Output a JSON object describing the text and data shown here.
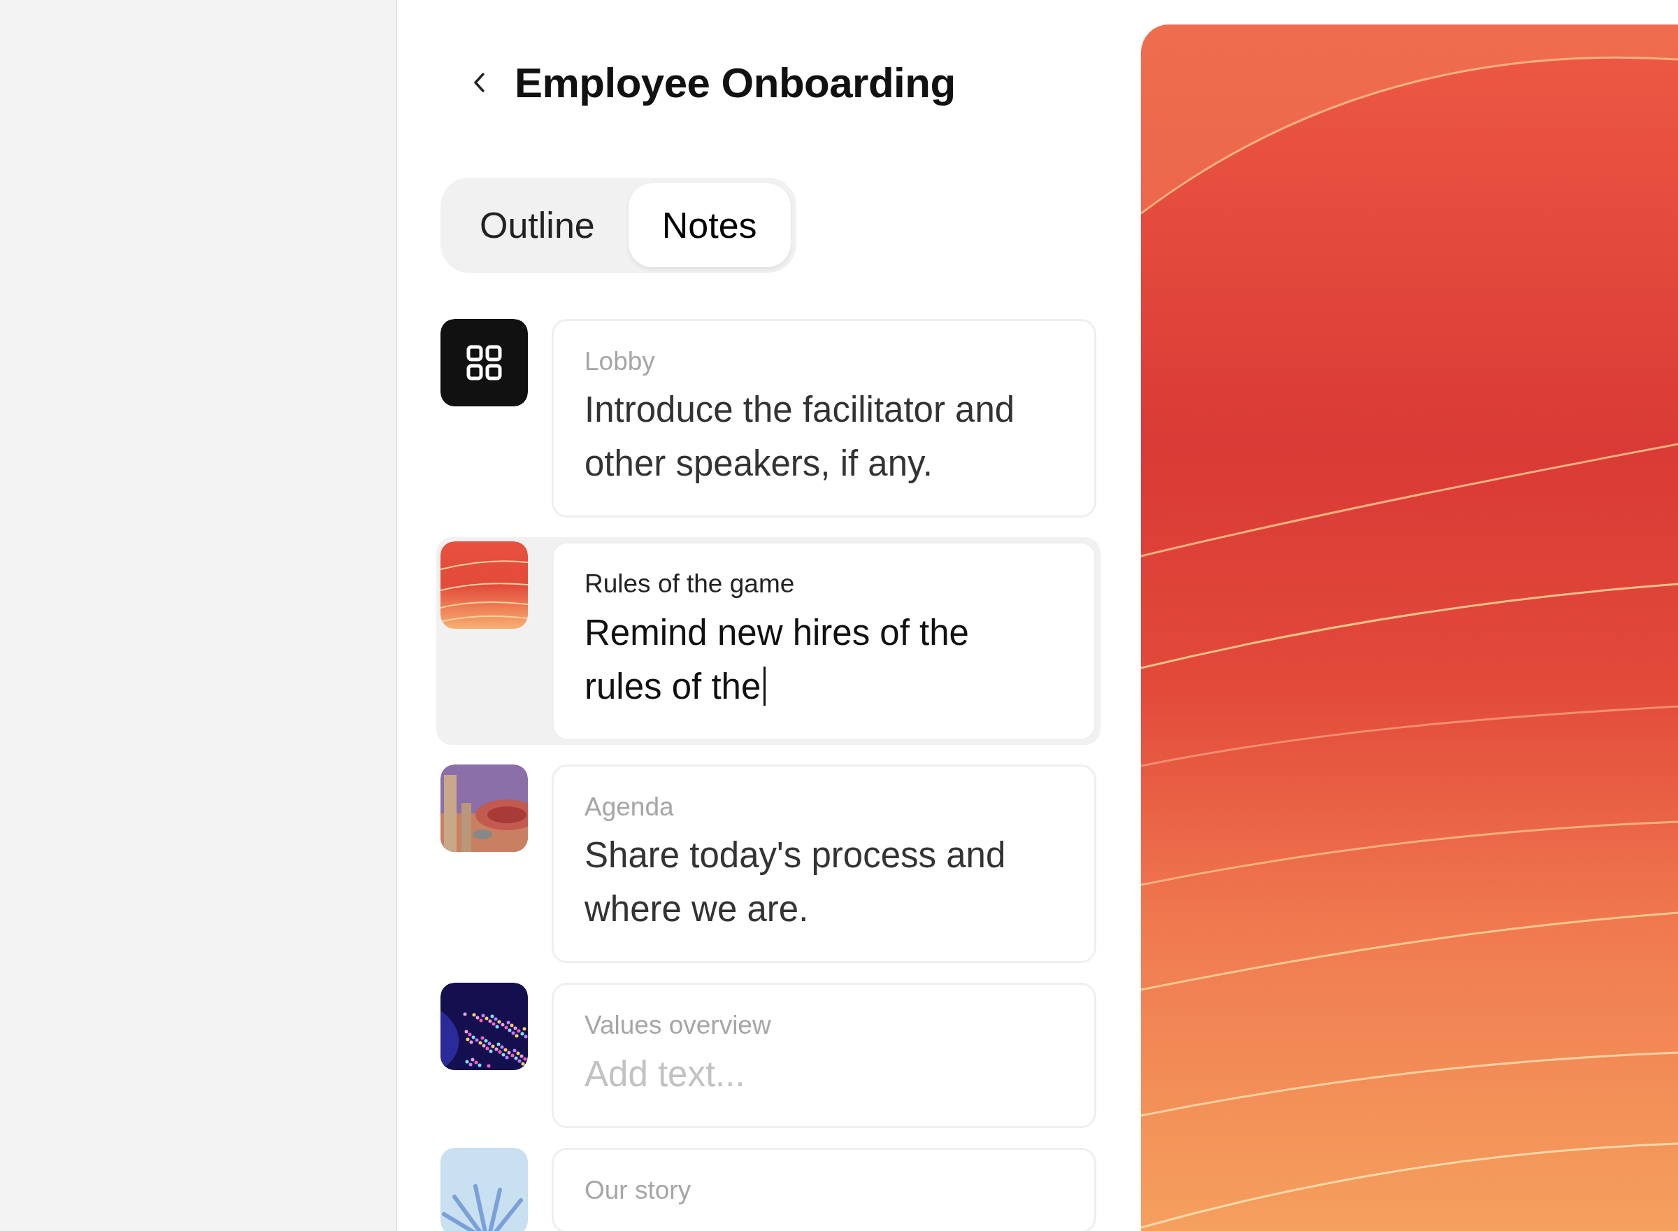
{
  "header": {
    "title": "Employee Onboarding"
  },
  "tabs": [
    {
      "label": "Outline",
      "selected": false
    },
    {
      "label": "Notes",
      "selected": true
    }
  ],
  "slides": [
    {
      "kind": "grid",
      "title": "Lobby",
      "note": "Introduce the facilitator and other speakers, if any.",
      "selected": false
    },
    {
      "kind": "waves",
      "title": "Rules of the game",
      "note": "Remind new hires of the rules of the",
      "selected": true
    },
    {
      "kind": "tubes",
      "title": "Agenda",
      "note": "Share today's process and where we are.",
      "selected": false
    },
    {
      "kind": "particles",
      "title": "Values overview",
      "placeholder": "Add text...",
      "selected": false
    },
    {
      "kind": "spikes",
      "title": "Our story",
      "selected": false
    }
  ]
}
